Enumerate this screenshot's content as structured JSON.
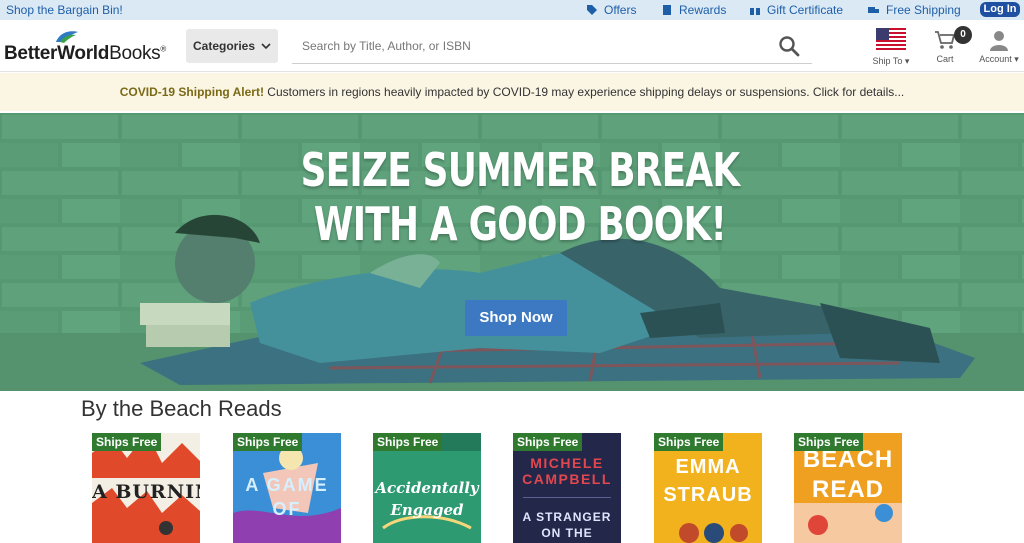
{
  "topbar": {
    "bargain_link": "Shop the Bargain Bin!",
    "offers": "Offers",
    "rewards": "Rewards",
    "gift_certificate": "Gift Certificate",
    "free_shipping": "Free Shipping",
    "login": "Log In"
  },
  "header": {
    "logo_bold": "BetterWorld",
    "logo_light": "Books",
    "logo_mark": "®",
    "categories_label": "Categories",
    "search_placeholder": "Search by Title, Author, or ISBN",
    "ship_to_label": "Ship To",
    "cart_label": "Cart",
    "cart_count": "0",
    "account_label": "Account"
  },
  "alert": {
    "title": "COVID-19 Shipping Alert!",
    "message": " Customers in regions heavily impacted by COVID-19 may experience shipping delays or suspensions. Click for details..."
  },
  "hero": {
    "headline_line1": "SEIZE SUMMER BREAK",
    "headline_line2": "WITH A GOOD BOOK!",
    "cta": "Shop Now"
  },
  "section": {
    "title": "By the Beach Reads"
  },
  "books": [
    {
      "badge": "Ships Free",
      "cover_text": "A BURNING",
      "cover_color": "#e04a2a"
    },
    {
      "badge": "Ships Free",
      "cover_text": "A GAME OF",
      "cover_color": "#3a8fd6"
    },
    {
      "badge": "Ships Free",
      "cover_text": "Accidentally Engaged",
      "cover_color": "#2e9a72"
    },
    {
      "badge": "Ships Free",
      "cover_text": "MICHELE CAMPBELL",
      "cover_subtext": "A STRANGER ON THE",
      "cover_color": "#23284a"
    },
    {
      "badge": "Ships Free",
      "cover_text": "EMMA STRAUB",
      "cover_color": "#f2b21e"
    },
    {
      "badge": "Ships Free",
      "cover_text": "BEACH READ",
      "cover_color": "#f0a020"
    }
  ],
  "colors": {
    "link_blue": "#1f5fa8",
    "login_blue": "#1f4fa0",
    "alert_bg": "#fbf5e4",
    "ships_free_green": "#2f7a2f",
    "cta_blue": "#3d79c2"
  }
}
